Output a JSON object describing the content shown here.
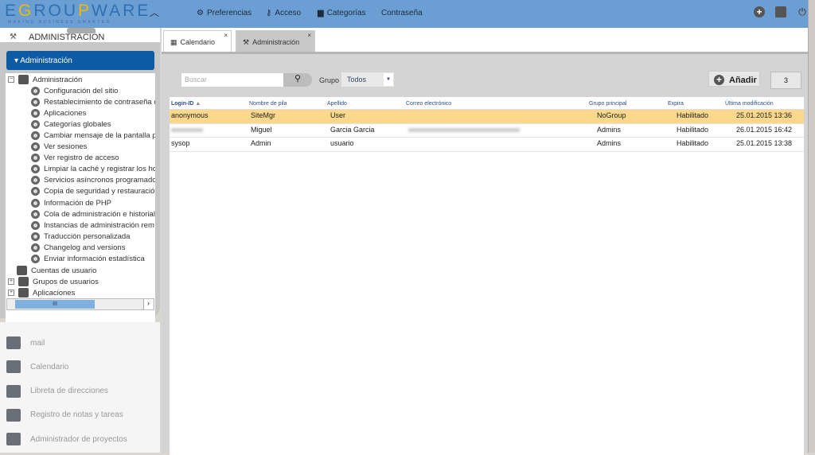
{
  "header": {
    "logo": "EGROUPWARE",
    "tagline": "MAKING BUSINESS SMARTER",
    "nav": [
      {
        "label": "Preferencias",
        "icon": "gear-icon"
      },
      {
        "label": "Acceso",
        "icon": "key-icon"
      },
      {
        "label": "Categorías",
        "icon": "folder-icon"
      },
      {
        "label": "Contraseña"
      }
    ]
  },
  "sidebar": {
    "title": "ADMINISTRACIÓN",
    "section": "Administración",
    "tree_root": "Administración",
    "items": [
      "Configuración del sitio",
      "Restablecimiento de contraseña d",
      "Aplicaciones",
      "Categorías globales",
      "Cambiar mensaje de la pantalla p",
      "Ver sesiones",
      "Ver registro de acceso",
      "Limpiar la caché y registrar los ho",
      "Servicios asíncronos programado",
      "Copia de seguridad y restauració",
      "Información de PHP",
      "Cola de administración e historial",
      "Instancias de administración rem",
      "Traducción personalizada",
      "Changelog and versions",
      "Enviar información estadística"
    ],
    "groups": [
      "Cuentas de usuario",
      "Grupos de usuarios",
      "Aplicaciones"
    ]
  },
  "apps": [
    "mail",
    "Calendario",
    "Libreta de direcciones",
    "Registro de notas y tareas",
    "Administrador de proyectos"
  ],
  "tabs": [
    {
      "label": "Calendario"
    },
    {
      "label": "Administración",
      "active": true
    }
  ],
  "toolbar": {
    "search_placeholder": "Buscar",
    "group_label": "Grupo",
    "group_value": "Todos",
    "add_label": "Añadir",
    "count": "3"
  },
  "table": {
    "columns": [
      "Login-ID",
      "Nombre de pila",
      "Apellido",
      "Correo electrónico",
      "Grupo principal",
      "Expira",
      "Última modificación"
    ],
    "rows": [
      {
        "login": "anonymous",
        "first": "SiteMgr",
        "last": "User",
        "email": "",
        "group": "NoGroup",
        "expires": "Habilitado",
        "modified": "25.01.2015 13:36",
        "selected": true
      },
      {
        "login": "",
        "first": "Miguel",
        "last": "Garcia Garcia",
        "email": "",
        "group": "Admins",
        "expires": "Habilitado",
        "modified": "26.01.2015 16:42"
      },
      {
        "login": "sysop",
        "first": "Admin",
        "last": "usuario",
        "email": "",
        "group": "Admins",
        "expires": "Habilitado",
        "modified": "25.01.2015 13:38"
      }
    ]
  },
  "colors": {
    "header": "#6b9fd3",
    "accent": "#0d5aa7",
    "selected_row": "#fbd88c"
  }
}
